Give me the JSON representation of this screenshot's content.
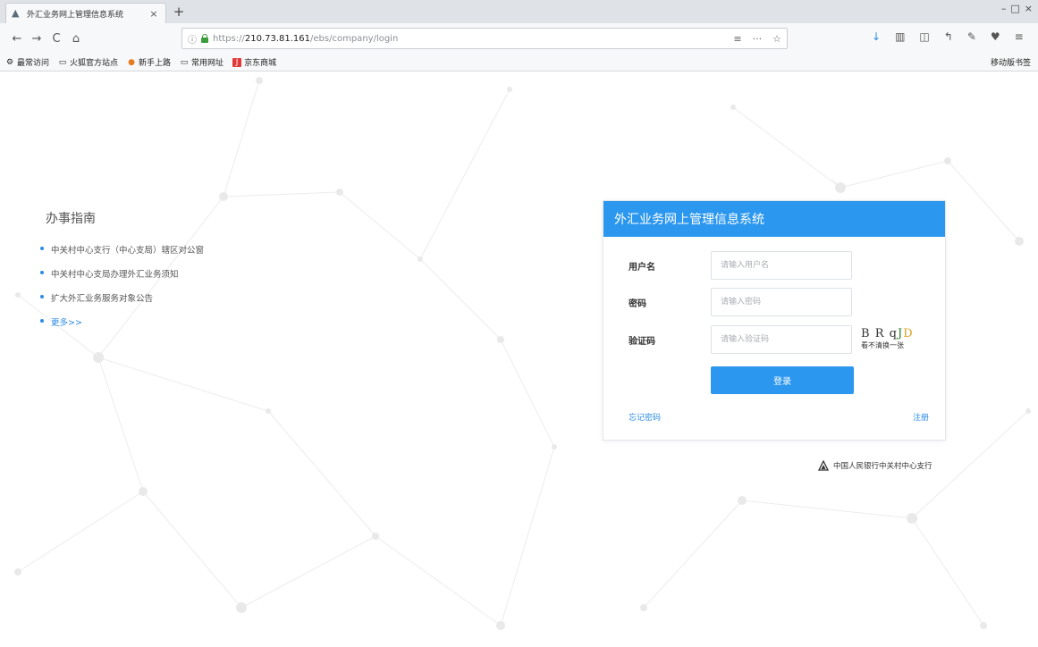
{
  "browser": {
    "tab_title": "外汇业务网上管理信息系统",
    "close_glyph": "×",
    "newtab_glyph": "+",
    "window_controls": [
      "–",
      "□",
      "×"
    ],
    "nav": {
      "back": "←",
      "forward": "→",
      "reload": "C",
      "home": "⌂"
    },
    "url_prefix": "https://",
    "url_host": "210.73.81.161",
    "url_path": "/ebs/company/login",
    "url_right_icons": [
      "≡",
      "···",
      "☆"
    ],
    "toolbar_icons": [
      "↓",
      "▥",
      "◫",
      "↰",
      "✎",
      "♥",
      "≡"
    ],
    "bookmarks": [
      {
        "label": "最常访问",
        "icon": "⚙"
      },
      {
        "label": "火狐官方站点",
        "icon": "▭"
      },
      {
        "label": "新手上路",
        "icon": "●"
      },
      {
        "label": "常用网址",
        "icon": "▭"
      },
      {
        "label": "京东商城",
        "icon": "J"
      }
    ],
    "mobile_bookmarks": "移动版书签"
  },
  "guide": {
    "title": "办事指南",
    "items": [
      "中关村中心支行（中心支局）辖区对公窗",
      "中关村中心支局办理外汇业务须知",
      "扩大外汇业务服务对象公告"
    ],
    "more": "更多>>"
  },
  "login": {
    "header": "外汇业务网上管理信息系统",
    "username_label": "用户名",
    "username_placeholder": "请输入用户名",
    "password_label": "密码",
    "password_placeholder": "请输入密码",
    "captcha_label": "验证码",
    "captcha_placeholder": "请输入验证码",
    "captcha_text": [
      "B",
      "R",
      "q",
      "J",
      "D"
    ],
    "captcha_hint": "看不清换一张",
    "submit": "登录",
    "forgot": "忘记密码",
    "register": "注册"
  },
  "footer": {
    "org": "中国人民银行中关村中心支行"
  },
  "colors": {
    "accent": "#2b97ef",
    "link": "#2b8be6"
  }
}
